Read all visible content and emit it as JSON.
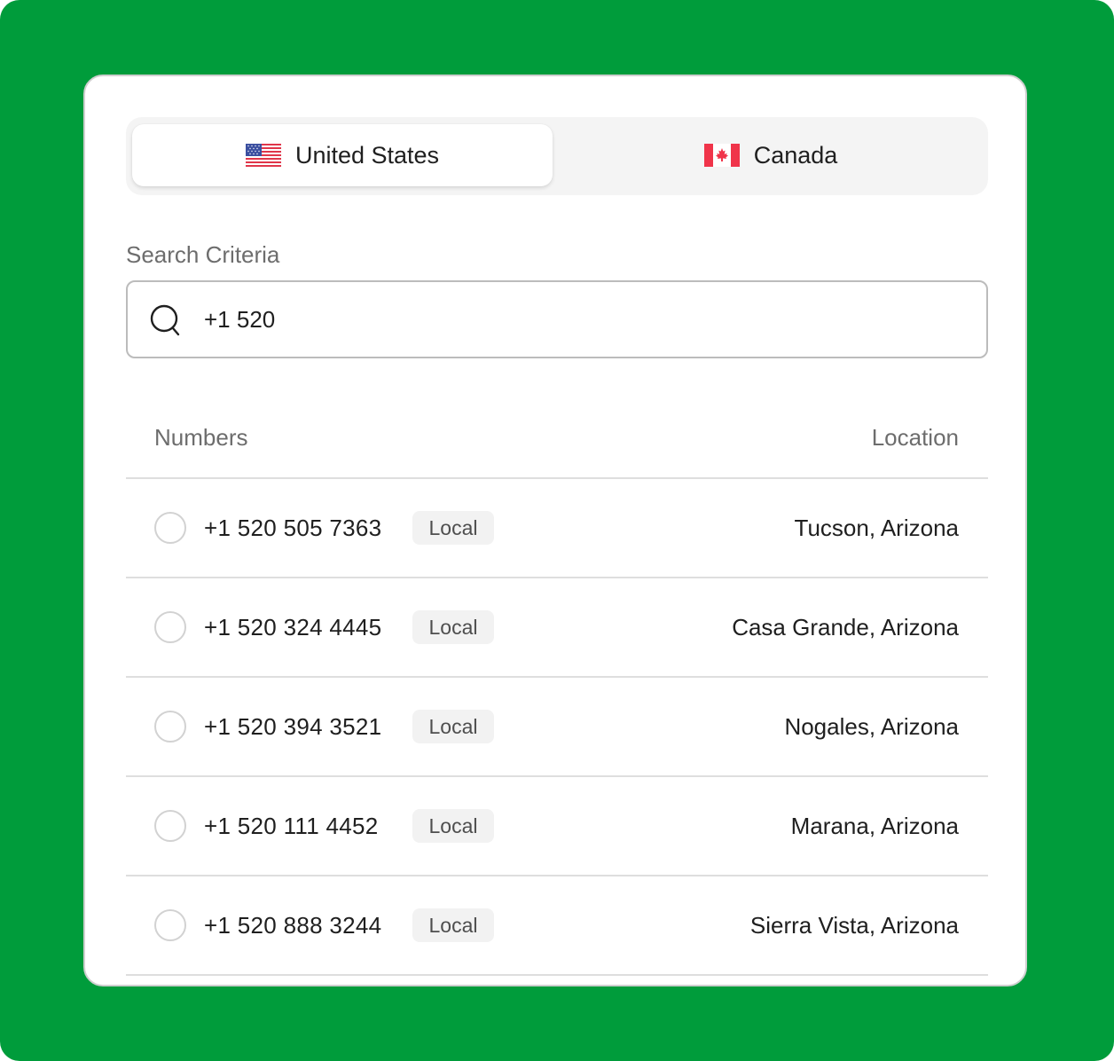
{
  "country_tabs": [
    {
      "label": "United States",
      "flag_icon": "us-flag-icon",
      "selected": true
    },
    {
      "label": "Canada",
      "flag_icon": "canada-flag-icon",
      "selected": false
    }
  ],
  "search": {
    "label": "Search Criteria",
    "value": "+1 520",
    "icon": "search-icon"
  },
  "table": {
    "headers": {
      "numbers": "Numbers",
      "location": "Location"
    },
    "rows": [
      {
        "number": "+1 520 505 7363",
        "type": "Local",
        "location": "Tucson, Arizona"
      },
      {
        "number": "+1 520 324 4445",
        "type": "Local",
        "location": "Casa Grande, Arizona"
      },
      {
        "number": "+1 520 394 3521",
        "type": "Local",
        "location": "Nogales, Arizona"
      },
      {
        "number": "+1 520 111 4452",
        "type": "Local",
        "location": "Marana, Arizona"
      },
      {
        "number": "+1 520 888 3244",
        "type": "Local",
        "location": "Sierra Vista, Arizona"
      }
    ]
  },
  "colors": {
    "background": "#009c3b",
    "card": "#ffffff",
    "text": "#1f1f1f",
    "muted": "#6d6d6d"
  }
}
